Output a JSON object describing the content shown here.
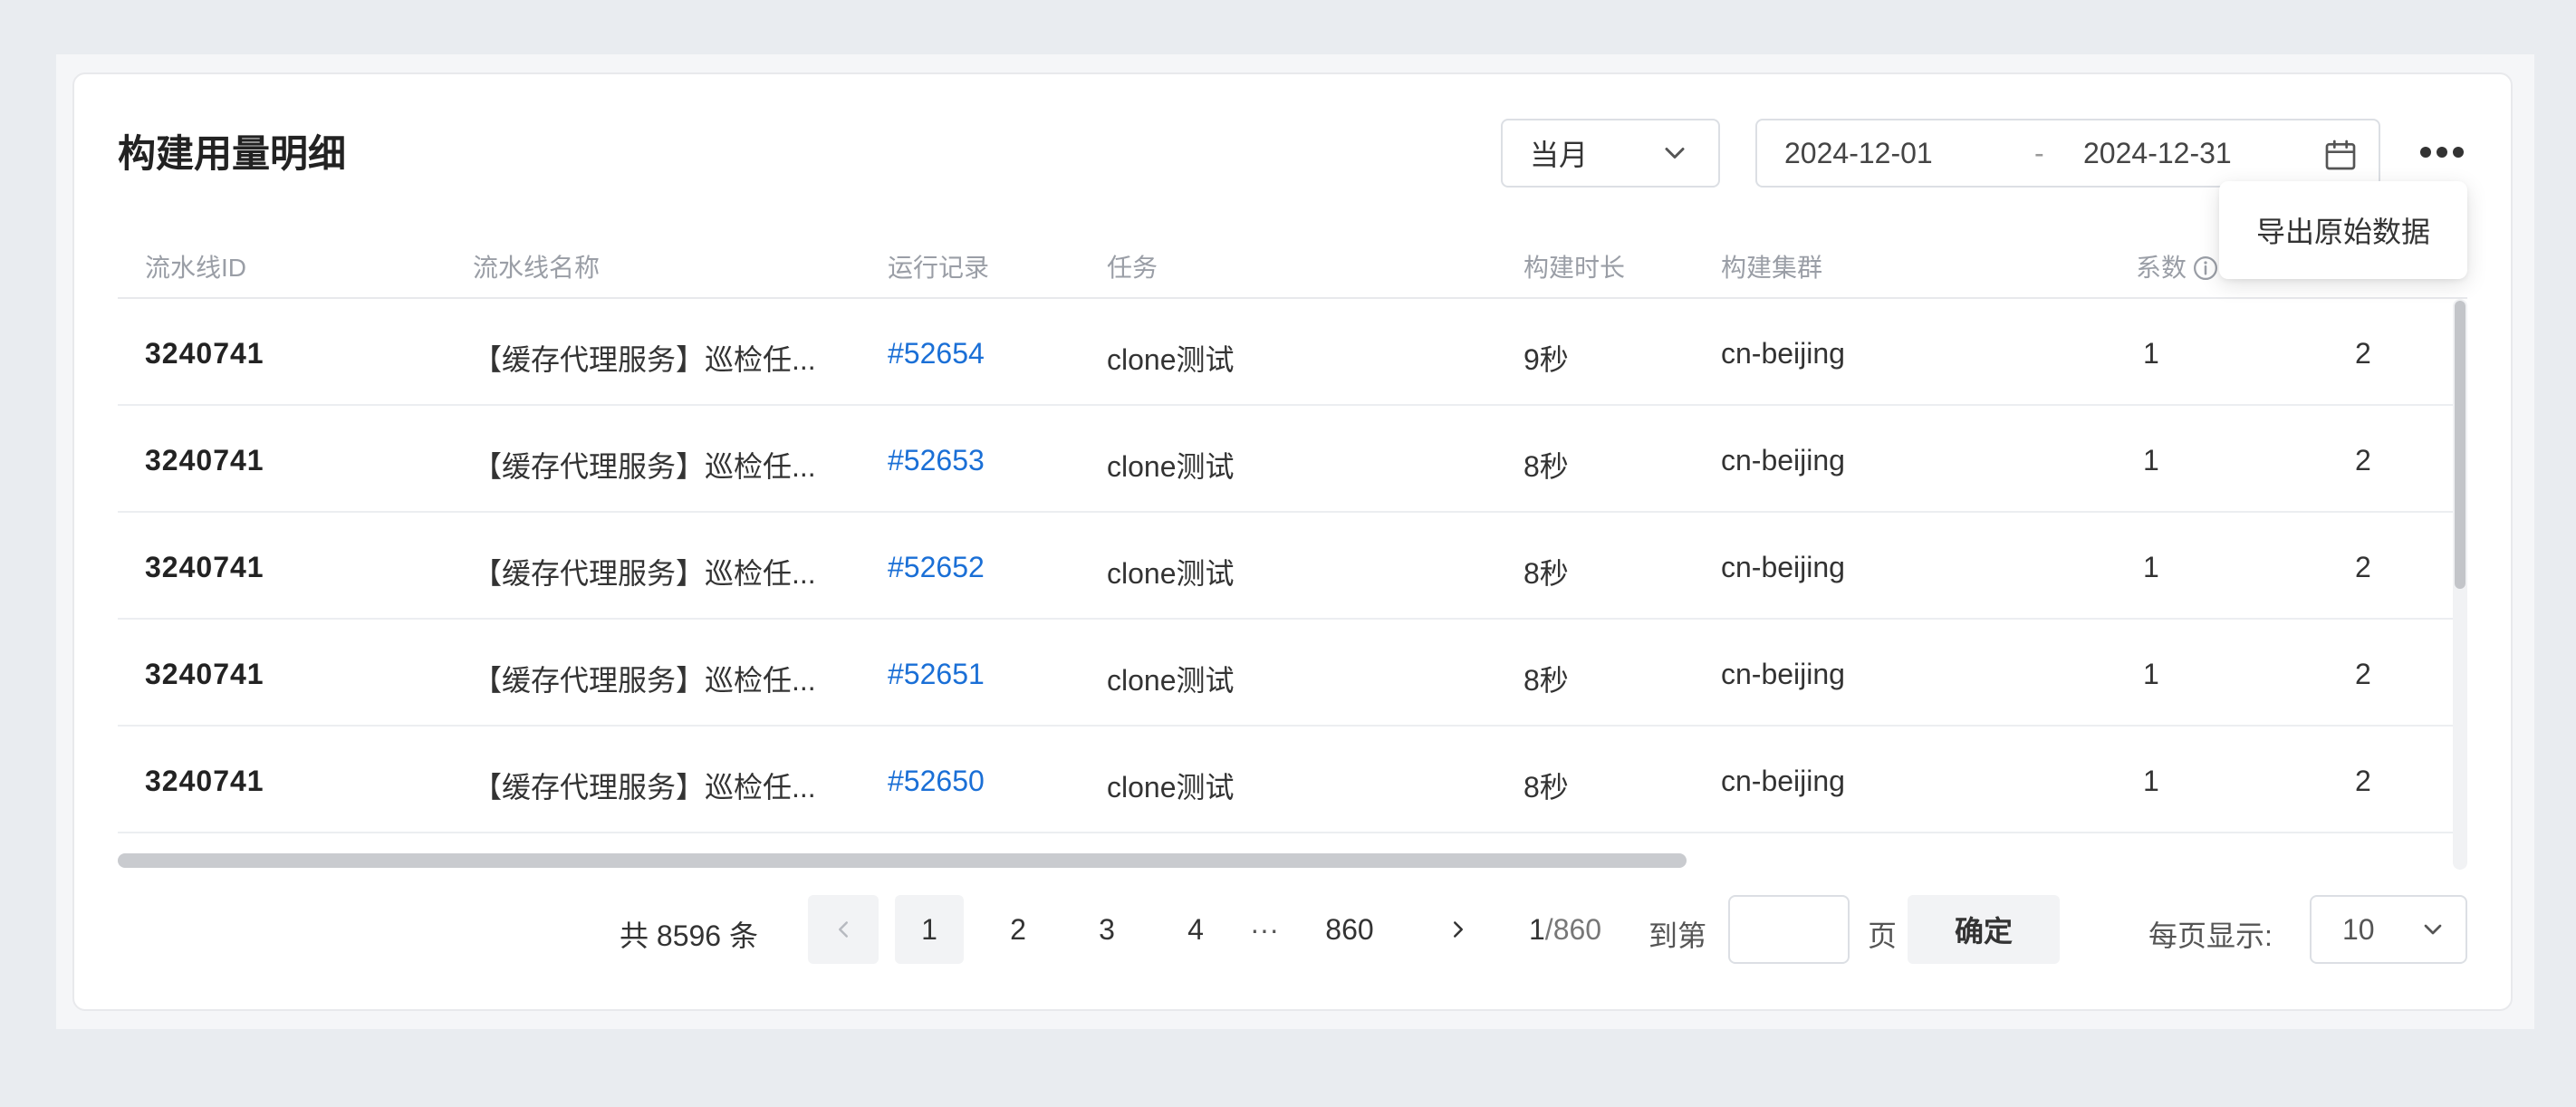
{
  "header": {
    "title": "构建用量明细",
    "period_value": "当月",
    "date_start": "2024-12-01",
    "date_separator": "-",
    "date_end": "2024-12-31",
    "more_menu": {
      "items": [
        "导出原始数据"
      ]
    }
  },
  "table": {
    "columns": [
      "流水线ID",
      "流水线名称",
      "运行记录",
      "任务",
      "构建时长",
      "构建集群",
      "系数"
    ],
    "rows": [
      [
        "3240741",
        "【缓存代理服务】巡检任...",
        "#52654",
        "clone测试",
        "9秒",
        "cn-beijing",
        "1",
        "2"
      ],
      [
        "3240741",
        "【缓存代理服务】巡检任...",
        "#52653",
        "clone测试",
        "8秒",
        "cn-beijing",
        "1",
        "2"
      ],
      [
        "3240741",
        "【缓存代理服务】巡检任...",
        "#52652",
        "clone测试",
        "8秒",
        "cn-beijing",
        "1",
        "2"
      ],
      [
        "3240741",
        "【缓存代理服务】巡检任...",
        "#52651",
        "clone测试",
        "8秒",
        "cn-beijing",
        "1",
        "2"
      ],
      [
        "3240741",
        "【缓存代理服务】巡检任...",
        "#52650",
        "clone测试",
        "8秒",
        "cn-beijing",
        "1",
        "2"
      ]
    ]
  },
  "pagination": {
    "total_text": "共 8596 条",
    "pages": [
      "1",
      "2",
      "3",
      "4",
      "···",
      "860"
    ],
    "current_page": "1",
    "total_pages": "/860",
    "jump_label": "到第",
    "jump_suffix": "页",
    "confirm_label": "确定",
    "page_size_label": "每页显示:",
    "page_size_value": "10"
  },
  "colors": {
    "link": "#1a6fd6",
    "header_text": "#9a9ea6",
    "border": "#dcdfe4"
  }
}
